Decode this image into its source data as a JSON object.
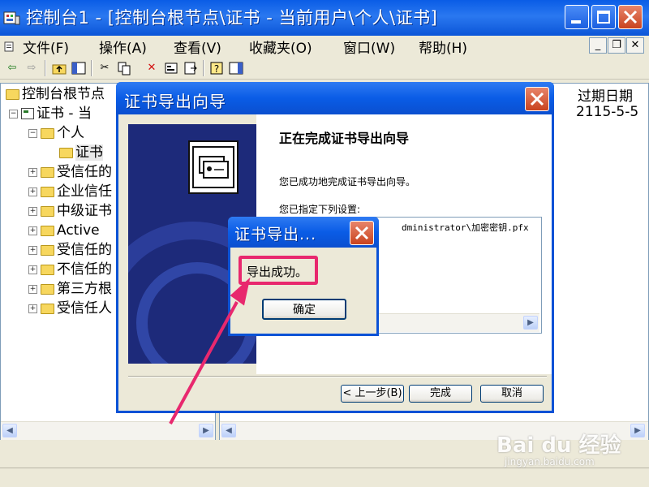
{
  "window": {
    "title": "控制台1 - [控制台根节点\\证书 - 当前用户\\个人\\证书]"
  },
  "menu": {
    "items": [
      "文件(F)",
      "操作(A)",
      "查看(V)",
      "收藏夹(O)",
      "窗口(W)",
      "帮助(H)"
    ]
  },
  "tree": {
    "root": "控制台根节点",
    "cert_node": "证书 - 当",
    "personal": "个人",
    "certificates": "证书",
    "items": [
      "受信任的",
      "企业信任",
      "中级证书",
      "Active",
      "受信任的",
      "不信任的",
      "第三方根",
      "受信任人"
    ]
  },
  "list": {
    "column_expiry": "过期日期",
    "row_expiry": "2115-5-5"
  },
  "wizard": {
    "title": "证书导出向导",
    "heading": "正在完成证书导出向导",
    "text_success": "您已成功地完成证书导出向导。",
    "text_settings": "您已指定下列设置:",
    "settings_row": "dministrator\\加密密钥.pfx",
    "btn_back": "< 上一步(B)",
    "btn_finish": "完成",
    "btn_cancel": "取消"
  },
  "msgbox": {
    "title": "证书导出...",
    "message": "导出成功。",
    "btn_ok": "确定"
  },
  "watermark": {
    "brand": "Bai du 经验",
    "url": "jingyan.baidu.com"
  },
  "colors": {
    "titlebar": "#0a5ce6",
    "highlight": "#e8286e",
    "wizard_side": "#1d2a7a"
  }
}
